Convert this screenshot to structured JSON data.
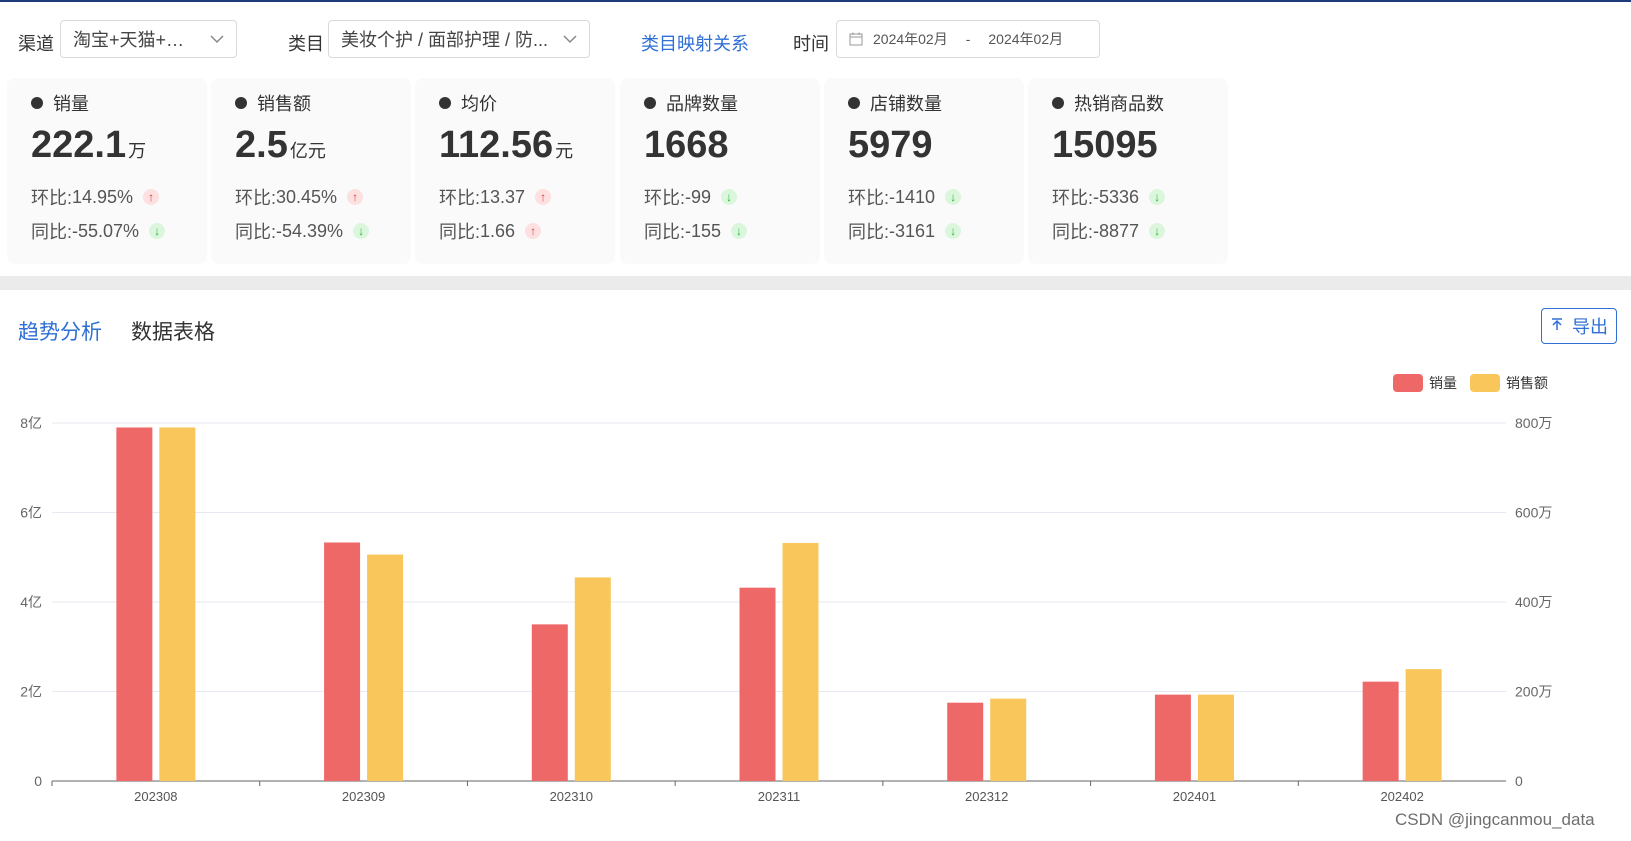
{
  "filters": {
    "channel_label": "渠道",
    "channel_value": "淘宝+天猫+京东",
    "category_label": "类目",
    "category_value": "美妆个护 / 面部护理 / 防...",
    "mapping_link": "类目映射关系",
    "time_label": "时间",
    "date_start": "2024年02月",
    "date_sep": "-",
    "date_end": "2024年02月"
  },
  "cards": [
    {
      "title": "销量",
      "value": "222.1",
      "unit": "万",
      "mom_label": "环比:",
      "mom": "14.95%",
      "mom_dir": "up",
      "yoy_label": "同比:",
      "yoy": "-55.07%",
      "yoy_dir": "down"
    },
    {
      "title": "销售额",
      "value": "2.5",
      "unit": "亿元",
      "mom_label": "环比:",
      "mom": "30.45%",
      "mom_dir": "up",
      "yoy_label": "同比:",
      "yoy": "-54.39%",
      "yoy_dir": "down"
    },
    {
      "title": "均价",
      "value": "112.56",
      "unit": "元",
      "mom_label": "环比:",
      "mom": "13.37",
      "mom_dir": "up",
      "yoy_label": "同比:",
      "yoy": "1.66",
      "yoy_dir": "up"
    },
    {
      "title": "品牌数量",
      "value": "1668",
      "unit": "",
      "mom_label": "环比:",
      "mom": "-99",
      "mom_dir": "down",
      "yoy_label": "同比:",
      "yoy": "-155",
      "yoy_dir": "down"
    },
    {
      "title": "店铺数量",
      "value": "5979",
      "unit": "",
      "mom_label": "环比:",
      "mom": "-1410",
      "mom_dir": "down",
      "yoy_label": "同比:",
      "yoy": "-3161",
      "yoy_dir": "down"
    },
    {
      "title": "热销商品数",
      "value": "15095",
      "unit": "",
      "mom_label": "环比:",
      "mom": "-5336",
      "mom_dir": "down",
      "yoy_label": "同比:",
      "yoy": "-8877",
      "yoy_dir": "down"
    }
  ],
  "tabs": {
    "trend": "趋势分析",
    "table": "数据表格"
  },
  "export_label": "导出",
  "colors": {
    "accent": "#2f6fd6",
    "sales_volume": "#ef6868",
    "sales_amount": "#f8c65a",
    "up": "#e23b3b",
    "down": "#1bbf2b"
  },
  "icons": {
    "chevron": "chevron-down-icon",
    "calendar": "calendar-icon",
    "export": "upload-icon",
    "bullet": "dot-icon"
  },
  "chart_data": {
    "type": "bar",
    "categories": [
      "202308",
      "202309",
      "202310",
      "202311",
      "202312",
      "202401",
      "202402"
    ],
    "series": [
      {
        "name": "销量",
        "axis": "right",
        "values": [
          790,
          533,
          350,
          432,
          175,
          193,
          222
        ]
      },
      {
        "name": "销售额",
        "axis": "left",
        "values": [
          7.9,
          5.06,
          4.55,
          5.32,
          1.84,
          1.93,
          2.5
        ]
      }
    ],
    "left_axis": {
      "ylim": [
        0,
        8
      ],
      "ticks": [
        "0",
        "2亿",
        "4亿",
        "6亿",
        "8亿"
      ]
    },
    "right_axis": {
      "ylim": [
        0,
        800
      ],
      "ticks": [
        "0",
        "200万",
        "400万",
        "600万",
        "800万"
      ]
    },
    "legend": "top-right",
    "grid": true
  },
  "watermark": "CSDN @jingcanmou_data"
}
